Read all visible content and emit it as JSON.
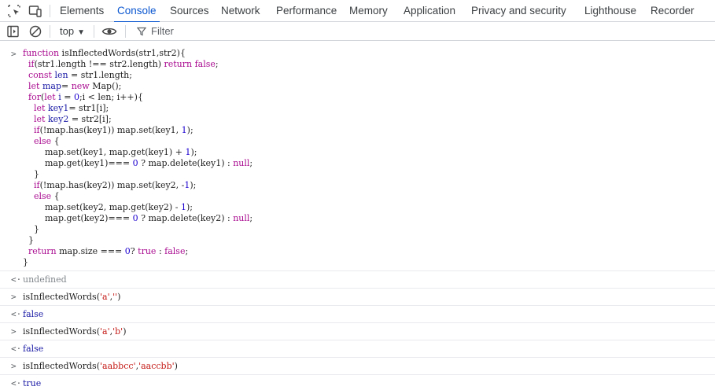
{
  "tabs": [
    {
      "label": "Elements",
      "active": false
    },
    {
      "label": "Console",
      "active": true
    },
    {
      "label": "Sources",
      "active": false
    },
    {
      "label": "Network",
      "active": false
    },
    {
      "label": "Performance",
      "active": false
    },
    {
      "label": "Memory",
      "active": false
    },
    {
      "label": "Application",
      "active": false
    },
    {
      "label": "Privacy and security",
      "active": false
    },
    {
      "label": "Lighthouse",
      "active": false
    },
    {
      "label": "Recorder",
      "active": false
    }
  ],
  "toolbar": {
    "context_label": "top",
    "filter_placeholder": "Filter"
  },
  "icons": {
    "inspect": "inspect-element-icon",
    "device": "device-toolbar-icon",
    "sidebar": "console-sidebar-icon",
    "clear": "clear-console-icon",
    "context_caret": "chevron-down-icon",
    "live_expression": "eye-icon",
    "filter": "filter-icon",
    "input_prompt": "chevron-right-icon",
    "output_prompt": "return-arrow-icon"
  },
  "colors": {
    "accent": "#0b57d0",
    "keyword": "#aa0d91",
    "variable": "#1a1aa6",
    "number": "#1c00cf",
    "string": "#c41a16",
    "muted": "#80868b"
  },
  "console": {
    "input_prompt": ">",
    "output_prompt": "<·",
    "code_lines": [
      [
        [
          "k",
          "function "
        ],
        [
          "p",
          "isInflectedWords(str1,str2){"
        ]
      ],
      [
        [
          "p",
          "  "
        ],
        [
          "k",
          "if"
        ],
        [
          "p",
          "(str1.length !== str2.length) "
        ],
        [
          "k",
          "return false"
        ],
        [
          "p",
          ";"
        ]
      ],
      [
        [
          "p",
          "  "
        ],
        [
          "k",
          "const "
        ],
        [
          "d",
          "len"
        ],
        [
          "p",
          " = str1.length;"
        ]
      ],
      [
        [
          "p",
          "  "
        ],
        [
          "k",
          "let "
        ],
        [
          "d",
          "map"
        ],
        [
          "p",
          "= "
        ],
        [
          "k",
          "new "
        ],
        [
          "p",
          "Map();"
        ]
      ],
      [
        [
          "p",
          "  "
        ],
        [
          "k",
          "for"
        ],
        [
          "p",
          "("
        ],
        [
          "k",
          "let "
        ],
        [
          "d",
          "i"
        ],
        [
          "p",
          " = "
        ],
        [
          "n",
          "0"
        ],
        [
          "p",
          ";i < len; i++){"
        ]
      ],
      [
        [
          "p",
          "    "
        ],
        [
          "k",
          "let "
        ],
        [
          "d",
          "key1"
        ],
        [
          "p",
          "= str1[i];"
        ]
      ],
      [
        [
          "p",
          "    "
        ],
        [
          "k",
          "let "
        ],
        [
          "d",
          "key2"
        ],
        [
          "p",
          " = str2[i];"
        ]
      ],
      [
        [
          "p",
          "    "
        ],
        [
          "k",
          "if"
        ],
        [
          "p",
          "(!map.has(key1)) map.set(key1, "
        ],
        [
          "n",
          "1"
        ],
        [
          "p",
          ");"
        ]
      ],
      [
        [
          "p",
          "    "
        ],
        [
          "k",
          "else"
        ],
        [
          "p",
          " {"
        ]
      ],
      [
        [
          "p",
          "        map.set(key1, map.get(key1) + "
        ],
        [
          "n",
          "1"
        ],
        [
          "p",
          ");"
        ]
      ],
      [
        [
          "p",
          "        map.get(key1)=== "
        ],
        [
          "n",
          "0"
        ],
        [
          "p",
          " ? map.delete(key1) : "
        ],
        [
          "k",
          "null"
        ],
        [
          "p",
          ";"
        ]
      ],
      [
        [
          "p",
          "    }"
        ]
      ],
      [
        [
          "p",
          "    "
        ],
        [
          "k",
          "if"
        ],
        [
          "p",
          "(!map.has(key2)) map.set(key2, -"
        ],
        [
          "n",
          "1"
        ],
        [
          "p",
          ");"
        ]
      ],
      [
        [
          "p",
          "    "
        ],
        [
          "k",
          "else"
        ],
        [
          "p",
          " {"
        ]
      ],
      [
        [
          "p",
          "        map.set(key2, map.get(key2) - "
        ],
        [
          "n",
          "1"
        ],
        [
          "p",
          ");"
        ]
      ],
      [
        [
          "p",
          "        map.get(key2)=== "
        ],
        [
          "n",
          "0"
        ],
        [
          "p",
          " ? map.delete(key2) : "
        ],
        [
          "k",
          "null"
        ],
        [
          "p",
          ";"
        ]
      ],
      [
        [
          "p",
          "    }"
        ]
      ],
      [
        [
          "p",
          "  }"
        ]
      ],
      [
        [
          "p",
          "  "
        ],
        [
          "k",
          "return "
        ],
        [
          "p",
          "map.size === "
        ],
        [
          "n",
          "0"
        ],
        [
          "p",
          "? "
        ],
        [
          "k",
          "true"
        ],
        [
          "p",
          " : "
        ],
        [
          "k",
          "false"
        ],
        [
          "p",
          ";"
        ]
      ],
      [
        [
          "p",
          "}"
        ]
      ]
    ],
    "result_undefined": "undefined",
    "entries": [
      {
        "input_fn": "isInflectedWords(",
        "arg1": "'a'",
        "comma": ",",
        "arg2": "''",
        "close": ")",
        "output": "false"
      },
      {
        "input_fn": "isInflectedWords(",
        "arg1": "'a'",
        "comma": ",",
        "arg2": "'b'",
        "close": ")",
        "output": "false"
      },
      {
        "input_fn": "isInflectedWords(",
        "arg1": "'aabbcc'",
        "comma": ",",
        "arg2": "'aaccbb'",
        "close": ")",
        "output": "true"
      }
    ]
  }
}
